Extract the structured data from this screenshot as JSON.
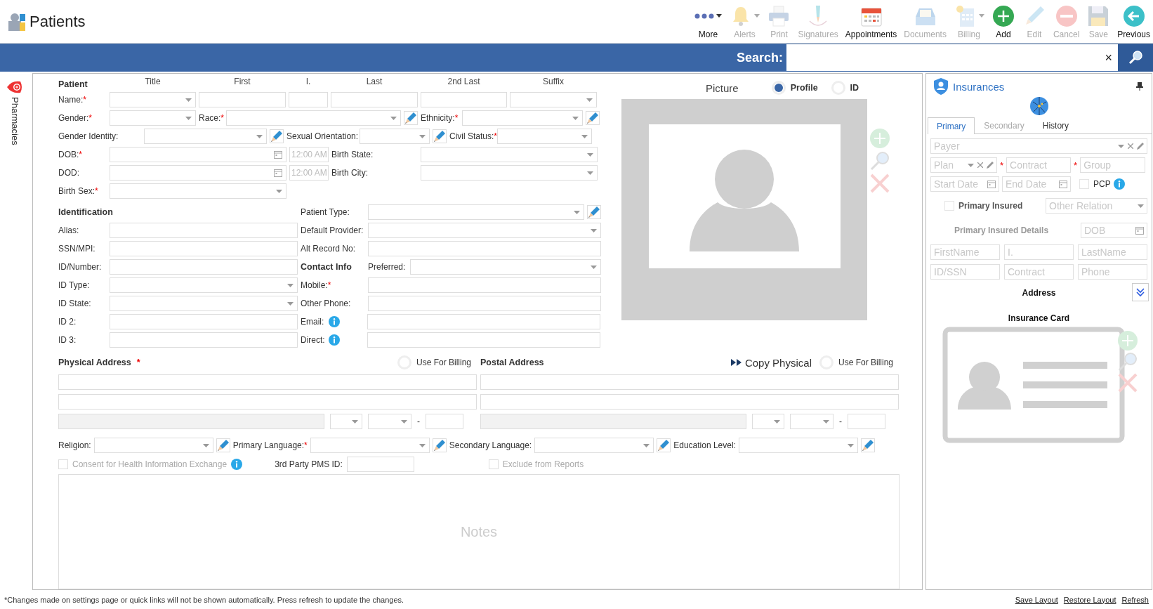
{
  "header": {
    "title": "Patients"
  },
  "toolbar": [
    {
      "label": "More",
      "enabled": true,
      "has_menu": true
    },
    {
      "label": "Alerts",
      "enabled": false,
      "has_menu": true
    },
    {
      "label": "Print",
      "enabled": false,
      "has_menu": false
    },
    {
      "label": "Signatures",
      "enabled": false,
      "has_menu": false
    },
    {
      "label": "Appointments",
      "enabled": true,
      "has_menu": false
    },
    {
      "label": "Documents",
      "enabled": false,
      "has_menu": false
    },
    {
      "label": "Billing",
      "enabled": false,
      "has_menu": true
    },
    {
      "label": "Add",
      "enabled": true,
      "has_menu": false
    },
    {
      "label": "Edit",
      "enabled": false,
      "has_menu": false
    },
    {
      "label": "Cancel",
      "enabled": false,
      "has_menu": false
    },
    {
      "label": "Save",
      "enabled": false,
      "has_menu": false
    },
    {
      "label": "Previous",
      "enabled": true,
      "has_menu": false
    }
  ],
  "search": {
    "label": "Search:",
    "clear": "×"
  },
  "side_tabs": [
    {
      "label": "Pharmacies"
    }
  ],
  "patient": {
    "heading": "Patient",
    "name_columns": [
      "Title",
      "First",
      "I.",
      "Last",
      "2nd Last",
      "Suffix"
    ],
    "rows": [
      [
        {
          "kind": "label",
          "text": "Name:",
          "required_mark": "*"
        },
        {
          "kind": "dropdown"
        },
        {
          "kind": "text"
        },
        {
          "kind": "text"
        },
        {
          "kind": "text"
        },
        {
          "kind": "text"
        },
        {
          "kind": "dropdown"
        }
      ],
      [
        {
          "kind": "label",
          "text": "Gender:",
          "required_mark": "*"
        },
        {
          "kind": "dropdown"
        },
        {
          "kind": "label",
          "text": "Race:",
          "required_mark": "*"
        },
        {
          "kind": "dropdown"
        },
        {
          "kind": "pencil"
        },
        {
          "kind": "label",
          "text": "Ethnicity:",
          "required_mark": "*"
        },
        {
          "kind": "dropdown"
        },
        {
          "kind": "pencil"
        }
      ],
      [
        {
          "kind": "label",
          "text": "Gender Identity:"
        },
        {
          "kind": "dropdown"
        },
        {
          "kind": "pencil"
        },
        {
          "kind": "label",
          "text": "Sexual Orientation:"
        },
        {
          "kind": "dropdown"
        },
        {
          "kind": "pencil"
        },
        {
          "kind": "label",
          "text": "Civil Status:",
          "required_mark": "*"
        },
        {
          "kind": "dropdown"
        }
      ],
      [
        {
          "kind": "label",
          "text": "DOB:",
          "required_mark": "*"
        },
        {
          "kind": "date"
        },
        {
          "kind": "time",
          "value": "12:00 AM",
          "disabled": true
        },
        {
          "kind": "label",
          "text": "Birth State:"
        },
        {
          "kind": "dropdown"
        }
      ],
      [
        {
          "kind": "label",
          "text": "DOD:"
        },
        {
          "kind": "date"
        },
        {
          "kind": "time",
          "value": "12:00 AM",
          "disabled": true
        },
        {
          "kind": "label",
          "text": "Birth City:"
        },
        {
          "kind": "dropdown"
        }
      ],
      [
        {
          "kind": "label",
          "text": "Birth Sex:",
          "required_mark": "*"
        },
        {
          "kind": "dropdown"
        }
      ]
    ]
  },
  "identification": {
    "rows": [
      [
        {
          "kind": "heading",
          "text": "Identification"
        },
        {
          "kind": "label",
          "text": "Patient Type:"
        },
        {
          "kind": "dropdown"
        },
        {
          "kind": "pencil"
        }
      ],
      [
        {
          "kind": "label",
          "text": "Alias:"
        },
        {
          "kind": "text"
        },
        {
          "kind": "label",
          "text": "Default Provider:"
        },
        {
          "kind": "dropdown"
        }
      ],
      [
        {
          "kind": "label",
          "text": "SSN/MPI:"
        },
        {
          "kind": "text"
        },
        {
          "kind": "label",
          "text": "Alt Record No:"
        },
        {
          "kind": "text"
        }
      ],
      [
        {
          "kind": "label",
          "text": "ID/Number:"
        },
        {
          "kind": "text"
        },
        {
          "kind": "heading",
          "text": "Contact Info"
        },
        {
          "kind": "label",
          "text": "Preferred:"
        },
        {
          "kind": "dropdown"
        }
      ],
      [
        {
          "kind": "label",
          "text": "ID Type:"
        },
        {
          "kind": "dropdown"
        },
        {
          "kind": "label",
          "text": "Mobile:",
          "required_mark": "*"
        },
        {
          "kind": "text"
        }
      ],
      [
        {
          "kind": "label",
          "text": "ID State:"
        },
        {
          "kind": "dropdown"
        },
        {
          "kind": "label",
          "text": "Other Phone:"
        },
        {
          "kind": "text"
        }
      ],
      [
        {
          "kind": "label",
          "text": "ID 2:"
        },
        {
          "kind": "text"
        },
        {
          "kind": "label",
          "text": "Email:"
        },
        {
          "kind": "info"
        },
        {
          "kind": "text"
        }
      ],
      [
        {
          "kind": "label",
          "text": "ID 3:"
        },
        {
          "kind": "text"
        },
        {
          "kind": "label",
          "text": "Direct:"
        },
        {
          "kind": "info"
        },
        {
          "kind": "text"
        }
      ]
    ]
  },
  "picture": {
    "label": "Picture",
    "options": [
      {
        "label": "Profile",
        "selected": true
      },
      {
        "label": "ID",
        "selected": false
      }
    ]
  },
  "addresses": [
    {
      "title": "Physical Address",
      "required_mark": "*",
      "use_for_billing": {
        "label": "Use For Billing",
        "selected": false
      },
      "separator": "-"
    },
    {
      "title": "Postal Address",
      "copy_button": {
        "label": "Copy Physical"
      },
      "use_for_billing": {
        "label": "Use For Billing",
        "selected": false
      },
      "separator": "-"
    }
  ],
  "demographics": [
    {
      "label": "Religion:"
    },
    {
      "label": "Primary Language:",
      "required_mark": "*"
    },
    {
      "label": "Secondary Language:"
    },
    {
      "label": "Education Level:"
    }
  ],
  "consent": {
    "label": "Consent for Health Information Exchange",
    "checked": false,
    "disabled": true
  },
  "pms_id": {
    "label": "3rd Party PMS ID:"
  },
  "exclude": {
    "label": "Exclude from Reports",
    "checked": false,
    "disabled": true
  },
  "notes": {
    "placeholder": "Notes"
  },
  "insurances": {
    "title": "Insurances",
    "tabs": [
      {
        "label": "Primary",
        "selected": true,
        "disabled": false
      },
      {
        "label": "Secondary",
        "selected": false,
        "disabled": true
      },
      {
        "label": "History",
        "selected": false,
        "disabled": false
      }
    ],
    "payer": {
      "placeholder": "Payer"
    },
    "plan": {
      "placeholder": "Plan"
    },
    "contract": {
      "placeholder": "Contract",
      "required_mark": "*"
    },
    "group": {
      "placeholder": "Group",
      "required_mark": "*"
    },
    "start_date": {
      "placeholder": "Start Date"
    },
    "end_date": {
      "placeholder": "End Date"
    },
    "pcp": {
      "label": "PCP",
      "checked": false
    },
    "primary_insured": {
      "label": "Primary Insured",
      "checked": false
    },
    "other_relation": {
      "placeholder": "Other Relation"
    },
    "details_title": "Primary Insured Details",
    "dob": {
      "placeholder": "DOB"
    },
    "insured_fields": [
      {
        "placeholder": "FirstName"
      },
      {
        "placeholder": "I."
      },
      {
        "placeholder": "LastName"
      },
      {
        "placeholder": "ID/SSN"
      },
      {
        "placeholder": "Contract"
      },
      {
        "placeholder": "Phone"
      }
    ],
    "address_title": "Address",
    "card_title": "Insurance Card"
  },
  "footer": {
    "note": "*Changes made on settings page or quick links will not be shown automatically. Press refresh to update the changes.",
    "links": [
      "Save Layout",
      "Restore Layout",
      "Refresh"
    ]
  }
}
